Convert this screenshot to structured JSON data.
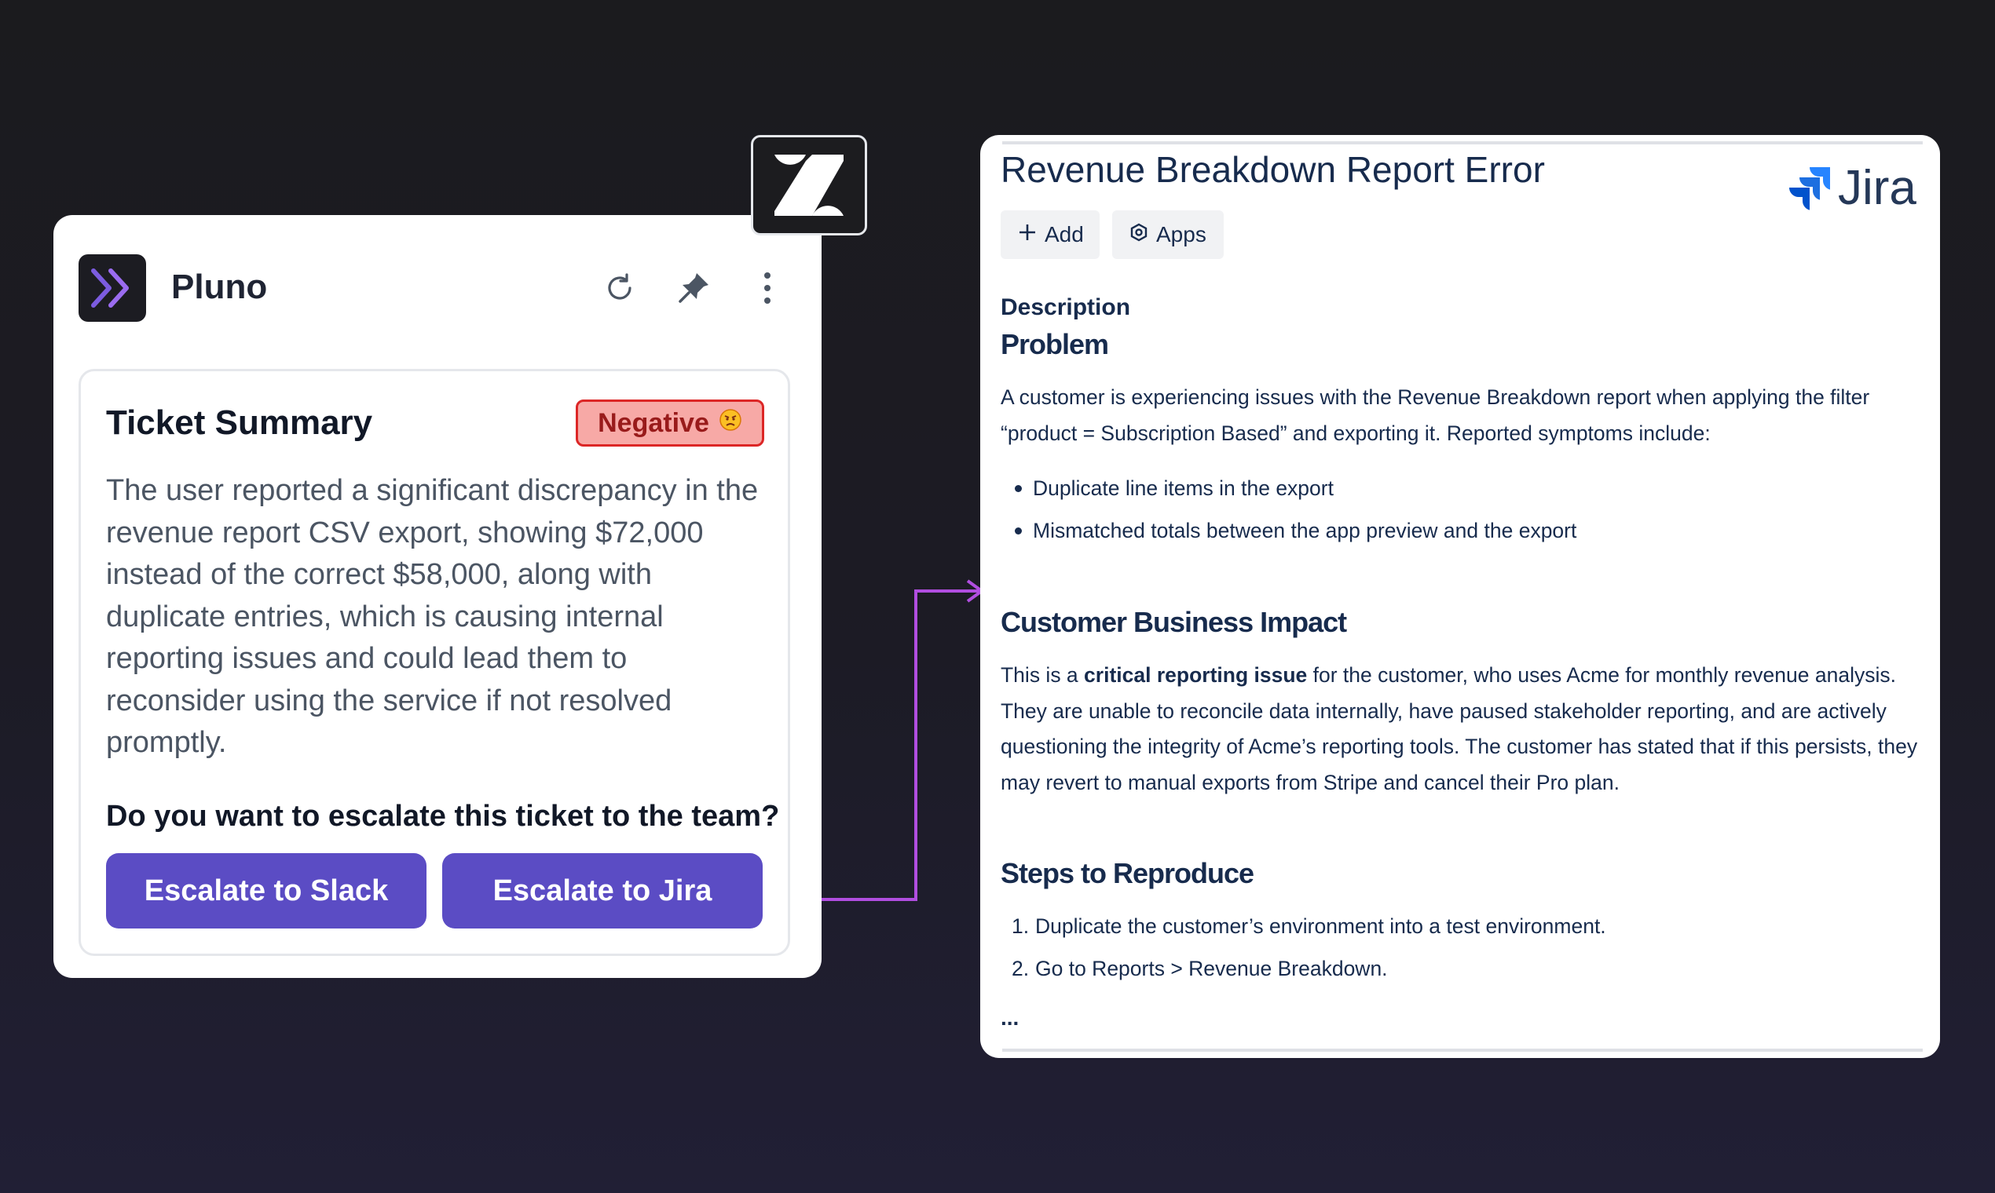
{
  "pluno": {
    "app_name": "Pluno",
    "icons": [
      "refresh-icon",
      "pin-icon",
      "more-vertical-icon"
    ],
    "summary": {
      "title": "Ticket Summary",
      "sentiment_label": "Negative",
      "sentiment_emoji": "😠",
      "text": "The user reported a significant discrepancy in the revenue report CSV export, showing $72,000 instead of the correct $58,000, along with duplicate entries, which is causing internal reporting issues and could lead them to reconsider using the service if not resolved promptly.",
      "question": "Do you want to escalate this ticket to the team?",
      "slack_button": "Escalate to Slack",
      "jira_button": "Escalate to Jira"
    }
  },
  "zendesk": {
    "icon": "zendesk-logo"
  },
  "jira": {
    "title": "Revenue Breakdown Report Error",
    "wordmark": "Jira",
    "add_button": "Add",
    "apps_button": "Apps",
    "description_label": "Description",
    "problem_heading": "Problem",
    "problem_text": "A customer is experiencing issues with the Revenue Breakdown report when applying the filter “product = Subscription Based” and exporting it. Reported symptoms include:",
    "symptoms": [
      "Duplicate line items in the export",
      "Mismatched totals between the app preview and the export"
    ],
    "impact_heading": "Customer Business Impact",
    "impact_prefix": "This is a ",
    "impact_bold": "critical reporting issue",
    "impact_rest": " for the customer, who uses Acme for monthly revenue analysis. They are unable to reconcile data internally, have paused stakeholder reporting, and are actively questioning the integrity of Acme’s reporting tools. The customer has stated that if this persists, they may revert to manual exports from Stripe and cancel their Pro plan.",
    "steps_heading": "Steps to Reproduce",
    "steps": [
      "Duplicate the customer’s environment into a test environment.",
      "Go to Reports > Revenue Breakdown."
    ],
    "step_numbers": [
      "1.",
      "2."
    ],
    "ellipsis": "..."
  },
  "colors": {
    "background": "#1b1b1e",
    "pluno_purple": "#5b4cc4",
    "connector": "#b14ee0",
    "negative_bg": "#f7a9a6",
    "negative_border": "#dc2626",
    "jira_blue": "#2684ff",
    "jira_text": "#172b4d"
  }
}
